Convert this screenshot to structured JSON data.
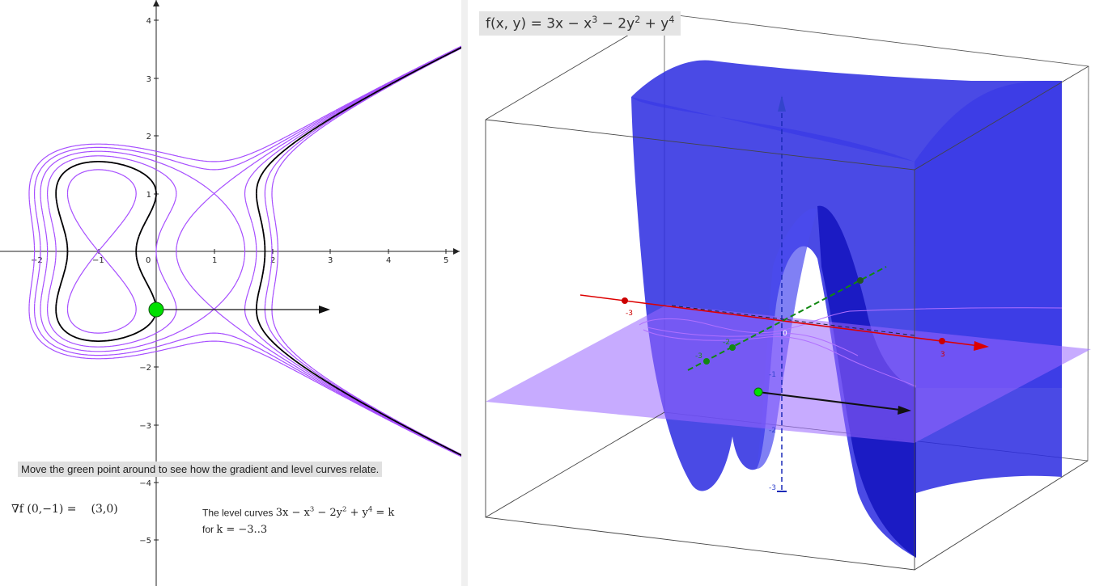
{
  "graphics2d": {
    "x_ticks": [
      "−2",
      "−1",
      "0",
      "1",
      "2",
      "3",
      "4",
      "5"
    ],
    "y_ticks": [
      "4",
      "3",
      "2",
      "1",
      "−2",
      "−3",
      "−4",
      "−5"
    ]
  },
  "hint": "Move the green point around to see how the gradient and level curves relate.",
  "gradient": {
    "label": "∇f (0,−1) =",
    "value": "(3,0)"
  },
  "level_caption": {
    "prefix": "The level curves",
    "eq_a": "3x − x",
    "eq_b": " − 2y",
    "eq_c": " + y",
    "eq_d": " = k",
    "exp3": "3",
    "exp2": "2",
    "exp4": "4",
    "for_text": "for",
    "range": "k = −3..3"
  },
  "formula": {
    "a": "f(x, y) = 3x − x",
    "b": " − 2y",
    "c": " + y",
    "exp3": "3",
    "exp2": "2",
    "exp4": "4"
  },
  "axes3d": {
    "x_labels": [
      "-3",
      "3"
    ],
    "y_labels": [
      "-3",
      "-2"
    ],
    "z_labels": [
      "-1",
      "-2",
      "-3"
    ],
    "origin": "0"
  },
  "colors": {
    "level_curve": "#a64dff",
    "highlight_curve": "#000000",
    "point": "#00e000",
    "surface": "#2222dd",
    "plane": "#9966ff",
    "x_axis": "#dd0000",
    "y_axis": "#118811"
  }
}
